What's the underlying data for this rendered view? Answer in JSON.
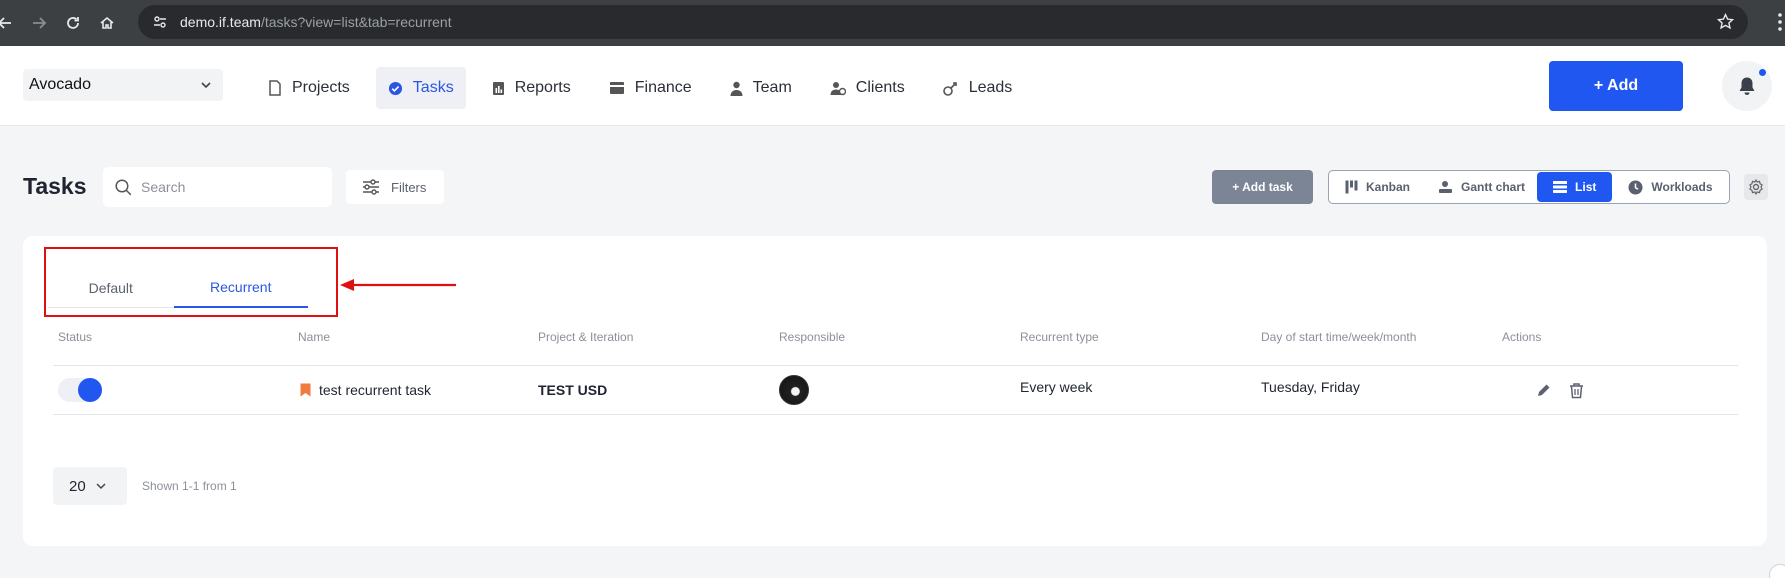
{
  "browser": {
    "url_host": "demo.if.team",
    "url_path": "/tasks?view=list&tab=recurrent"
  },
  "header": {
    "project": "Avocado",
    "nav": [
      {
        "label": "Projects",
        "icon": "document-icon"
      },
      {
        "label": "Tasks",
        "icon": "check-circle-icon",
        "active": true
      },
      {
        "label": "Reports",
        "icon": "report-icon"
      },
      {
        "label": "Finance",
        "icon": "wallet-icon"
      },
      {
        "label": "Team",
        "icon": "person-icon"
      },
      {
        "label": "Clients",
        "icon": "clients-icon"
      },
      {
        "label": "Leads",
        "icon": "leads-icon"
      }
    ],
    "add_label": "+ Add"
  },
  "toolbar": {
    "title": "Tasks",
    "search_placeholder": "Search",
    "filters_label": "Filters",
    "add_task_label": "+ Add task",
    "views": [
      "Kanban",
      "Gantt chart",
      "List",
      "Workloads"
    ],
    "active_view": "List"
  },
  "tabs": {
    "default": "Default",
    "recurrent": "Recurrent",
    "active": "Recurrent"
  },
  "table": {
    "headers": {
      "status": "Status",
      "name": "Name",
      "project": "Project & Iteration",
      "responsible": "Responsible",
      "recurrent_type": "Recurrent type",
      "day": "Day of start time/week/month",
      "actions": "Actions"
    },
    "rows": [
      {
        "status_on": true,
        "name": "test recurrent task",
        "project": "TEST USD",
        "recurrent_type": "Every week",
        "day": "Tuesday, Friday"
      }
    ]
  },
  "pagination": {
    "page_size": "20",
    "shown": "Shown 1-1 from 1"
  },
  "colors": {
    "accent": "#1f57f0",
    "annotation": "#e01010",
    "bookmark": "#f07b3f"
  }
}
